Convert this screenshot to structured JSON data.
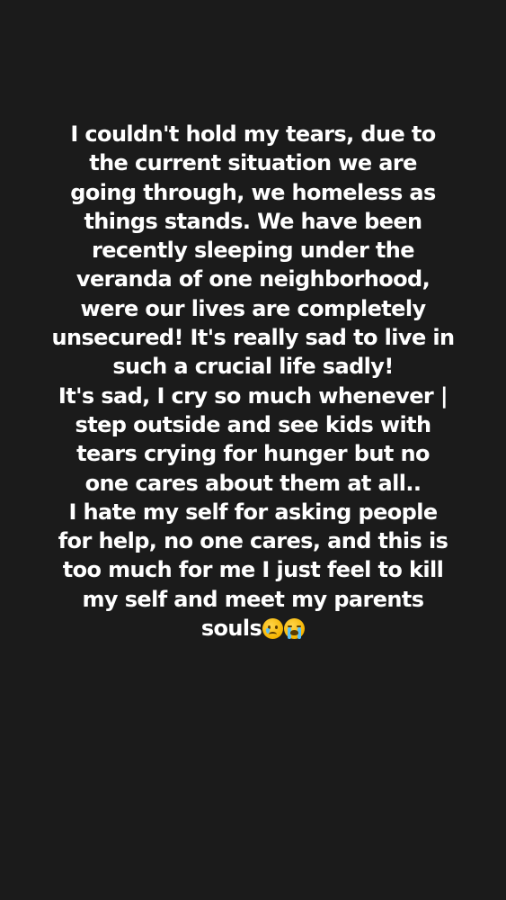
{
  "story": {
    "lines": [
      "I couldn't hold my tears, due to",
      "the current situation we are",
      "going through, we homeless as",
      "things stands. We have been",
      "recently sleeping under the",
      "veranda of one neighborhood,",
      "were our lives are completely",
      "unsecured! It's really sad to live in",
      "such a crucial life sadly!",
      "It's sad, I cry so much whenever |",
      "step outside and see kids with",
      "tears crying for hunger but no",
      "one cares about them at all..",
      "I hate my self for asking people",
      "for help, no one cares, and this is",
      "too much for me I just feel to kill",
      "my self and meet my parents",
      "souls"
    ],
    "emojis": [
      "crying-face-emoji",
      "loudly-crying-face-emoji"
    ]
  },
  "colors": {
    "background": "#1b1b1b",
    "text": "#ffffff"
  }
}
